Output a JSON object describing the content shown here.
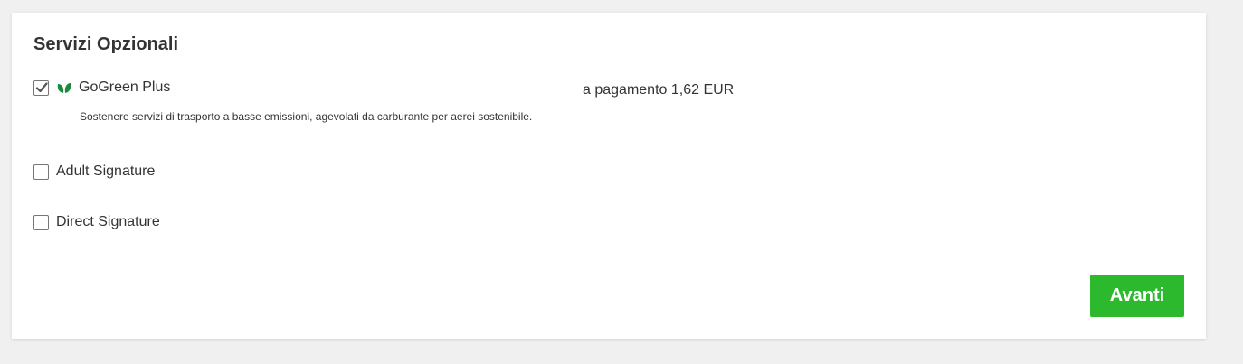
{
  "section": {
    "title": "Servizi Opzionali"
  },
  "options": [
    {
      "label": "GoGreen Plus",
      "checked": true,
      "icon": "leaf-icon",
      "description": "Sostenere servizi di trasporto a basse emissioni, agevolati da carburante per aerei sostenibile.",
      "price": "a pagamento 1,62 EUR"
    },
    {
      "label": "Adult Signature",
      "checked": false
    },
    {
      "label": "Direct Signature",
      "checked": false
    }
  ],
  "actions": {
    "next_label": "Avanti"
  },
  "colors": {
    "accent": "#2db92d",
    "leaf": "#1a8a3a",
    "background": "#f0f0f0",
    "card": "#ffffff",
    "text": "#333333"
  }
}
